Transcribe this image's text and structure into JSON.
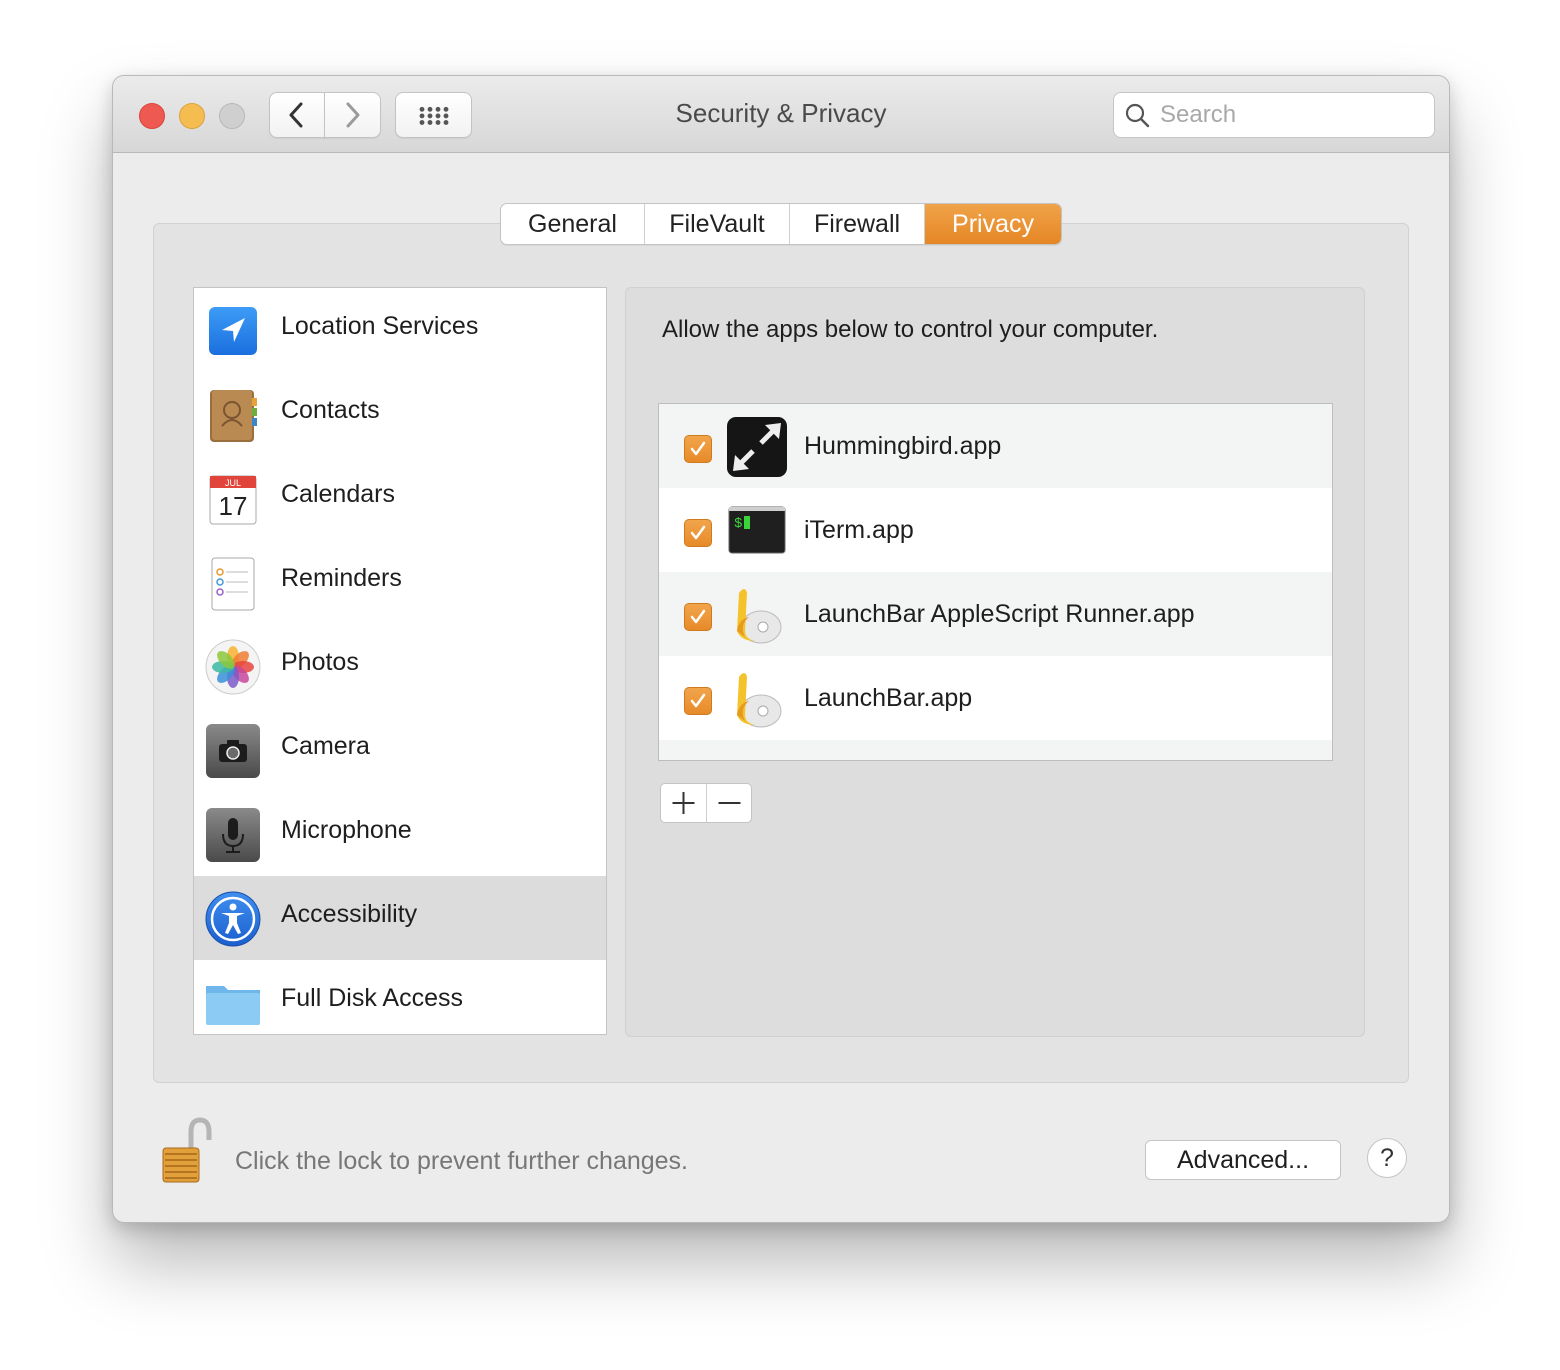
{
  "window": {
    "title": "Security & Privacy",
    "search_placeholder": "Search"
  },
  "tabs": [
    {
      "label": "General",
      "active": false
    },
    {
      "label": "FileVault",
      "active": false
    },
    {
      "label": "Firewall",
      "active": false
    },
    {
      "label": "Privacy",
      "active": true
    }
  ],
  "sidebar": {
    "items": [
      {
        "label": "Location Services",
        "icon": "location-arrow-icon",
        "selected": false
      },
      {
        "label": "Contacts",
        "icon": "contacts-book-icon",
        "selected": false
      },
      {
        "label": "Calendars",
        "icon": "calendar-icon",
        "month": "JUL",
        "day": "17",
        "selected": false
      },
      {
        "label": "Reminders",
        "icon": "reminders-icon",
        "selected": false
      },
      {
        "label": "Photos",
        "icon": "photos-icon",
        "selected": false
      },
      {
        "label": "Camera",
        "icon": "camera-icon",
        "selected": false
      },
      {
        "label": "Microphone",
        "icon": "microphone-icon",
        "selected": false
      },
      {
        "label": "Accessibility",
        "icon": "accessibility-icon",
        "selected": true
      },
      {
        "label": "Full Disk Access",
        "icon": "folder-icon",
        "selected": false
      }
    ]
  },
  "main": {
    "heading": "Allow the apps below to control your computer.",
    "apps": [
      {
        "name": "Hummingbird.app",
        "checked": true,
        "icon": "hummingbird-icon"
      },
      {
        "name": "iTerm.app",
        "checked": true,
        "icon": "iterm-icon",
        "prompt": "$"
      },
      {
        "name": "LaunchBar AppleScript Runner.app",
        "checked": true,
        "icon": "launchbar-icon"
      },
      {
        "name": "LaunchBar.app",
        "checked": true,
        "icon": "launchbar-icon"
      }
    ]
  },
  "footer": {
    "lock_text": "Click the lock to prevent further changes.",
    "advanced_label": "Advanced...",
    "help_label": "?"
  },
  "colors": {
    "accent": "#e8892a",
    "close": "#ee5a52",
    "minimize": "#f5bd4f",
    "zoom": "#cfcfcf"
  }
}
